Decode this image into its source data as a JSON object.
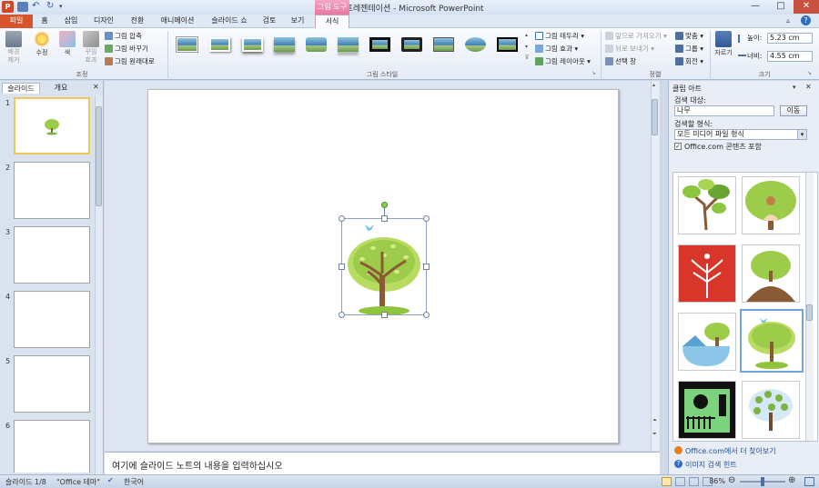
{
  "app": {
    "title": "새 프레젠테이션 - Microsoft PowerPoint",
    "context_tab_group": "그림 도구"
  },
  "tabs": [
    "파일",
    "홈",
    "삽입",
    "디자인",
    "전환",
    "애니메이션",
    "슬라이드 쇼",
    "검토",
    "보기",
    "서식"
  ],
  "ribbon": {
    "adjust": {
      "remove_bg": "배경\n제거",
      "corrections": "수정",
      "color": "색",
      "artistic": "꾸밈\n효과",
      "compress": "그림 압축",
      "change": "그림 바꾸기",
      "reset": "그림 원래대로",
      "label": "조정"
    },
    "styles": {
      "label": "그림 스타일",
      "border": "그림 테두리",
      "effects": "그림 효과",
      "layout": "그림 레이아웃"
    },
    "arrange": {
      "label": "정렬",
      "bring_forward": "앞으로 가져오기",
      "send_backward": "뒤로 보내기",
      "selection_pane": "선택 창",
      "align": "맞춤",
      "group": "그룹",
      "rotate": "회전"
    },
    "size": {
      "label": "크기",
      "crop": "자르기",
      "height_label": "높이:",
      "height_value": "5.23 cm",
      "width_label": "너비:",
      "width_value": "4.55 cm"
    }
  },
  "left_panel": {
    "tab_slides": "슬라이드",
    "tab_outline": "개요",
    "slide_numbers": [
      "1",
      "2",
      "3",
      "4",
      "5",
      "6"
    ]
  },
  "notes": {
    "placeholder": "여기에 슬라이드 노트의 내용을 입력하십시오"
  },
  "clip_art": {
    "title": "클립 아트",
    "search_label": "검색 대상:",
    "search_value": "나무",
    "go_button": "이동",
    "results_label": "검색할 형식:",
    "results_value": "모든 미디어 파일 형식",
    "include_office": "Office.com 콘텐츠 포함",
    "more_link": "Office.com에서 더 찾아보기",
    "hint_link": "이미지 검색 힌트"
  },
  "status": {
    "slide_info": "슬라이드 1/8",
    "theme": "\"Office 테마\"",
    "language": "한국어",
    "zoom": "86%"
  },
  "colors": {
    "file_tab": "#d6552d",
    "context_tab": "#e7799f",
    "link": "#1d4e9e"
  }
}
